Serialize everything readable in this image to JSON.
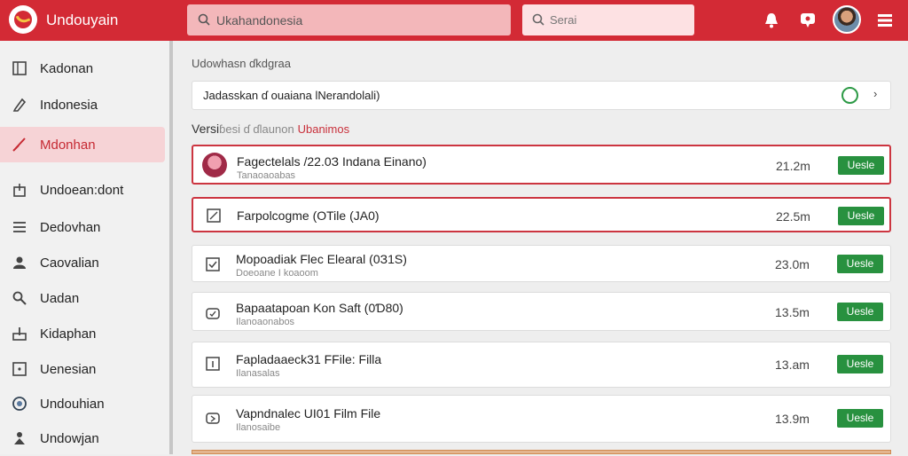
{
  "header": {
    "app_title": "Undouyain",
    "search_main": "Ukahandonesia",
    "search_small": "Serai",
    "icons": [
      "logo-icon",
      "bell-icon",
      "chat-icon",
      "avatar",
      "menu-icon"
    ]
  },
  "sidebar": {
    "items": [
      {
        "label": "Kadonan",
        "icon": "square-icon"
      },
      {
        "label": "Indonesia",
        "icon": "pen-icon"
      },
      {
        "label": "Mdonhan",
        "icon": "check-icon",
        "active": true
      },
      {
        "label": "Undoean:dont",
        "icon": "box-icon"
      },
      {
        "label": "Dedovhan",
        "icon": "list-icon"
      },
      {
        "label": "Caovalian",
        "icon": "user-icon"
      },
      {
        "label": "Uadan",
        "icon": "search-icon"
      },
      {
        "label": "Kidaphan",
        "icon": "upload-icon"
      },
      {
        "label": "Uenesian",
        "icon": "square-dot-icon"
      },
      {
        "label": "Undouhian",
        "icon": "globe-icon"
      },
      {
        "label": "Undowjan",
        "icon": "person-icon"
      }
    ]
  },
  "main": {
    "heading": "Udowhasn ɗkdgraa",
    "path": "Jadasskan ɗ ouaiana lNerandolali)",
    "section": {
      "lead": "Versi",
      "mid": "ɓesi ɗ ɗlaunon",
      "accent": "Ubanimos"
    },
    "rows": [
      {
        "name": "Fagectelals /22.0З Indana Einano)",
        "sub": "Tanaoaoabas",
        "size": "21.2m",
        "button": "Uesle",
        "icon": "avatar-thumb",
        "highlight": true
      },
      {
        "name": "Farpolcogme (OTile (JA0)",
        "sub": "",
        "size": "22.5m",
        "button": "Uesle",
        "icon": "square-icon",
        "highlight": true
      },
      {
        "name": "Mopoadiak Flec Elearal (0З1S)",
        "sub": "Doeoane I koaoom",
        "size": "23.0m",
        "button": "Uesle",
        "icon": "checkbox-icon"
      },
      {
        "name": "Bapaatapoan Kon Saft (0Ɗ80)",
        "sub": "Ilanoaonabos",
        "size": "13.5m",
        "button": "Uesle",
        "icon": "tray-check-icon"
      },
      {
        "name": "Fapladaaeck31 FFile: Filla",
        "sub": "Ilanasalas",
        "size": "13.am",
        "button": "Uesle",
        "icon": "info-icon"
      },
      {
        "name": "Vapndnalec UI01 Film File",
        "sub": "Ilanosaibe",
        "size": "13.9m",
        "button": "Uesle",
        "icon": "tray-icon"
      }
    ]
  },
  "colors": {
    "brand": "#d32a35",
    "accent_green": "#28913f",
    "highlight_border": "#cc3540"
  }
}
